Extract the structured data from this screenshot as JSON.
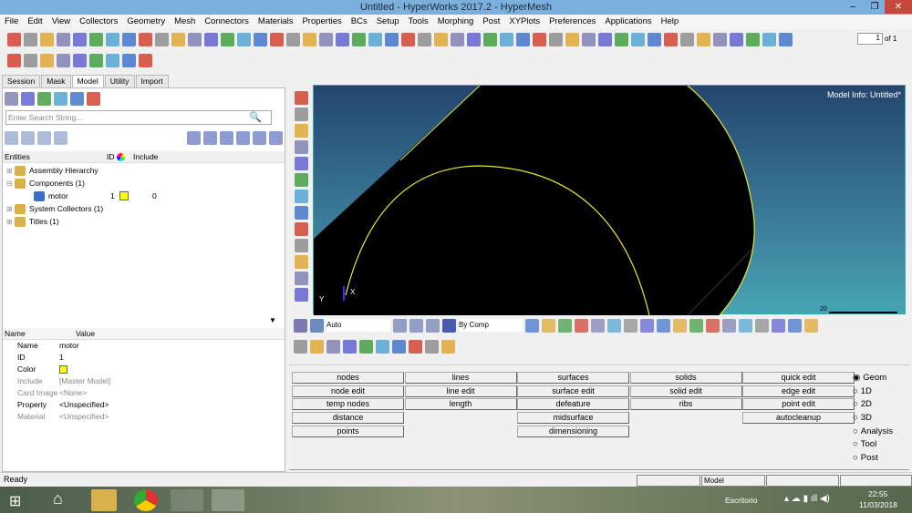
{
  "window": {
    "title": "Untitled - HyperWorks 2017.2 - HyperMesh"
  },
  "menu": [
    "File",
    "Edit",
    "View",
    "Collectors",
    "Geometry",
    "Mesh",
    "Connectors",
    "Materials",
    "Properties",
    "BCs",
    "Setup",
    "Tools",
    "Morphing",
    "Post",
    "XYPlots",
    "Preferences",
    "Applications",
    "Help"
  ],
  "toolbar": {
    "page_value": "1",
    "page_of": "of 1"
  },
  "tabs": [
    {
      "label": "Session"
    },
    {
      "label": "Mask"
    },
    {
      "label": "Model",
      "active": true
    },
    {
      "label": "Utility"
    },
    {
      "label": "Import"
    }
  ],
  "browser": {
    "search_placeholder": "Enter Search String...",
    "columns": [
      "Entities",
      "ID",
      "Include"
    ],
    "tree": [
      {
        "label": "Assembly Hierarchy"
      },
      {
        "label": "Components (1)"
      },
      {
        "label": "motor",
        "id": "1",
        "include": "0",
        "color": "#ffff00"
      },
      {
        "label": "System Collectors (1)"
      },
      {
        "label": "Titles (1)"
      }
    ]
  },
  "properties": {
    "columns": [
      "Name",
      "Value"
    ],
    "rows": [
      {
        "name": "Name",
        "value": "motor"
      },
      {
        "name": "ID",
        "value": "1"
      },
      {
        "name": "Color",
        "value": "",
        "color": "#ffff00"
      },
      {
        "name": "Include",
        "value": "[Master Model]",
        "disabled": true
      },
      {
        "name": "Card Image",
        "value": "<None>",
        "disabled": true
      },
      {
        "name": "Property",
        "value": "<Unspecified>"
      },
      {
        "name": "Material",
        "value": "<Unspecified>",
        "disabled": true
      }
    ]
  },
  "viewport": {
    "model_info": "Model Info: Untitled*",
    "scale_label": "20",
    "axis_y": "Y",
    "axis_x": "X"
  },
  "viewtoolbar": {
    "display_mode": "Auto",
    "color_mode": "By Comp"
  },
  "panel": {
    "columns": [
      [
        "nodes",
        "node edit",
        "temp nodes",
        "distance",
        "points"
      ],
      [
        "lines",
        "line edit",
        "length"
      ],
      [
        "surfaces",
        "surface edit",
        "defeature",
        "midsurface",
        "dimensioning"
      ],
      [
        "solids",
        "solid edit",
        "ribs"
      ],
      [
        "quick edit",
        "edge edit",
        "point edit",
        "autocleanup"
      ]
    ],
    "radios": [
      "Geom",
      "1D",
      "2D",
      "3D",
      "Analysis",
      "Tool",
      "Post"
    ],
    "selected_radio": "Geom"
  },
  "status": {
    "text": "Ready",
    "model": "Model"
  },
  "taskbar": {
    "desktop": "Escritorio",
    "time": "22:55",
    "date": "11/03/2018"
  },
  "colors": {
    "accent": "#7cb0dc",
    "geometry_edge": "#e8e830"
  }
}
